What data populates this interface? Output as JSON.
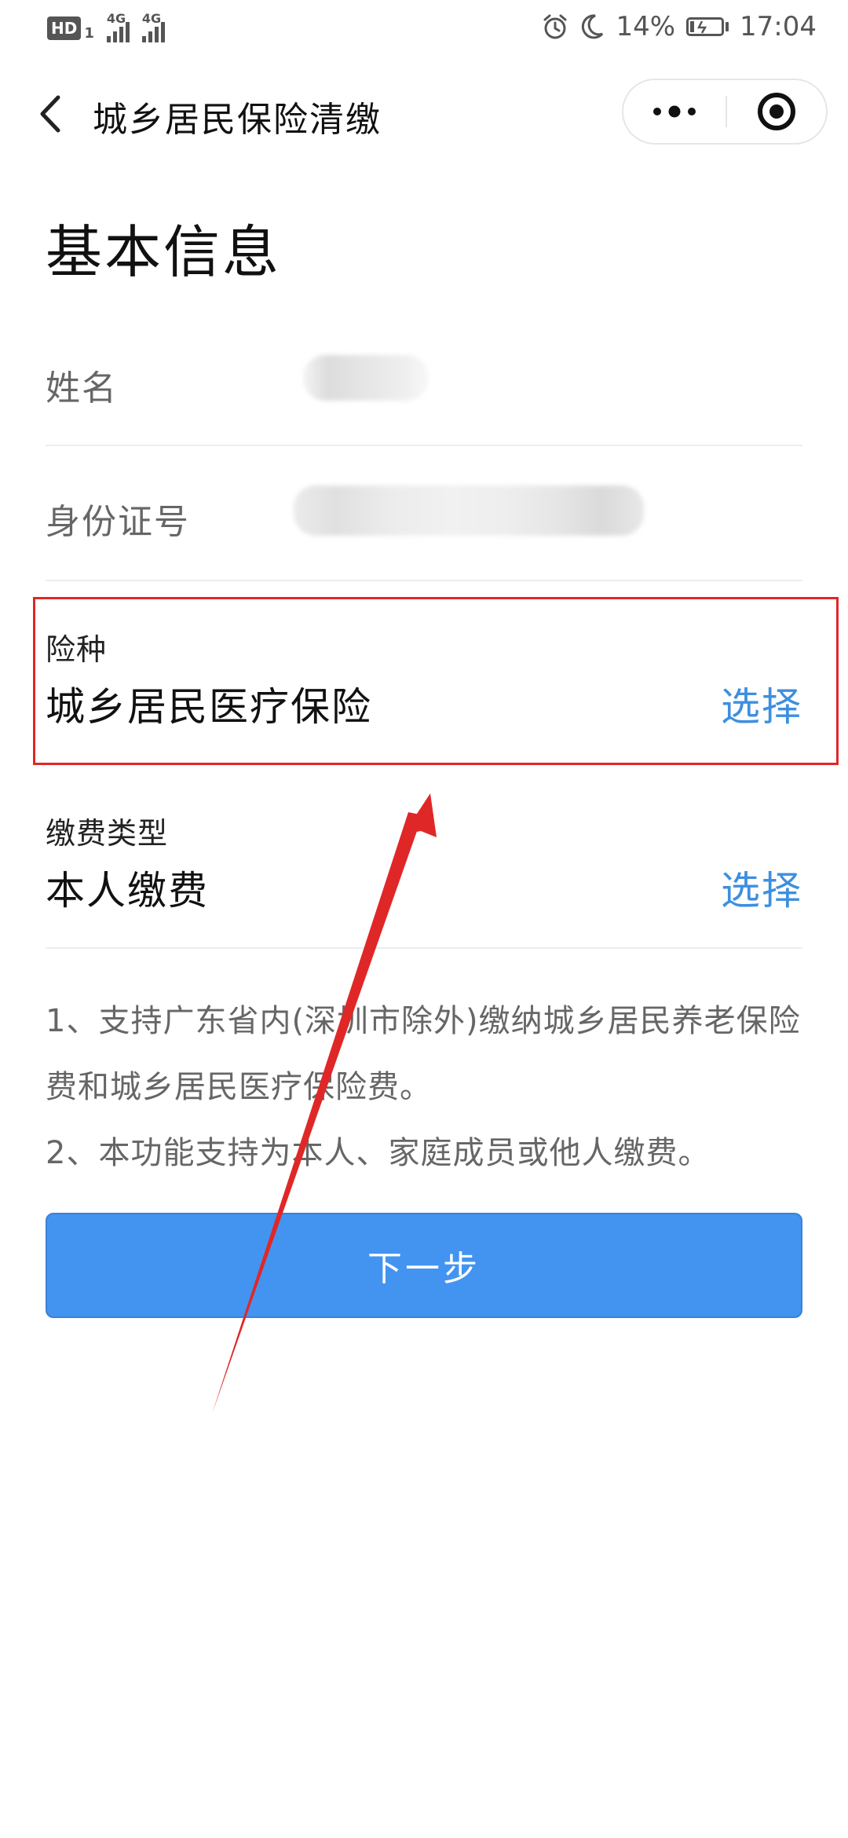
{
  "status_bar": {
    "hd": "HD",
    "hd_sub": "1",
    "net1": "4G",
    "net2": "4G",
    "battery_percent": "14%",
    "time": "17:04",
    "battery_level": 0.14
  },
  "nav": {
    "title": "城乡居民保险清缴"
  },
  "page": {
    "section_title": "基本信息"
  },
  "form": {
    "name_label": "姓名",
    "id_label": "身份证号",
    "insurance_type_label": "险种",
    "insurance_type_value": "城乡居民医疗保险",
    "insurance_type_action": "选择",
    "payment_type_label": "缴费类型",
    "payment_type_value": "本人缴费",
    "payment_type_action": "选择"
  },
  "notes": [
    "1、支持广东省内(深圳市除外)缴纳城乡居民养老保险费和城乡居民医疗保险费。",
    "2、本功能支持为本人、家庭成员或他人缴费。"
  ],
  "actions": {
    "next_label": "下一步"
  },
  "colors": {
    "accent": "#3d8fe0",
    "button": "#4394f0",
    "annotation": "#e02727"
  }
}
